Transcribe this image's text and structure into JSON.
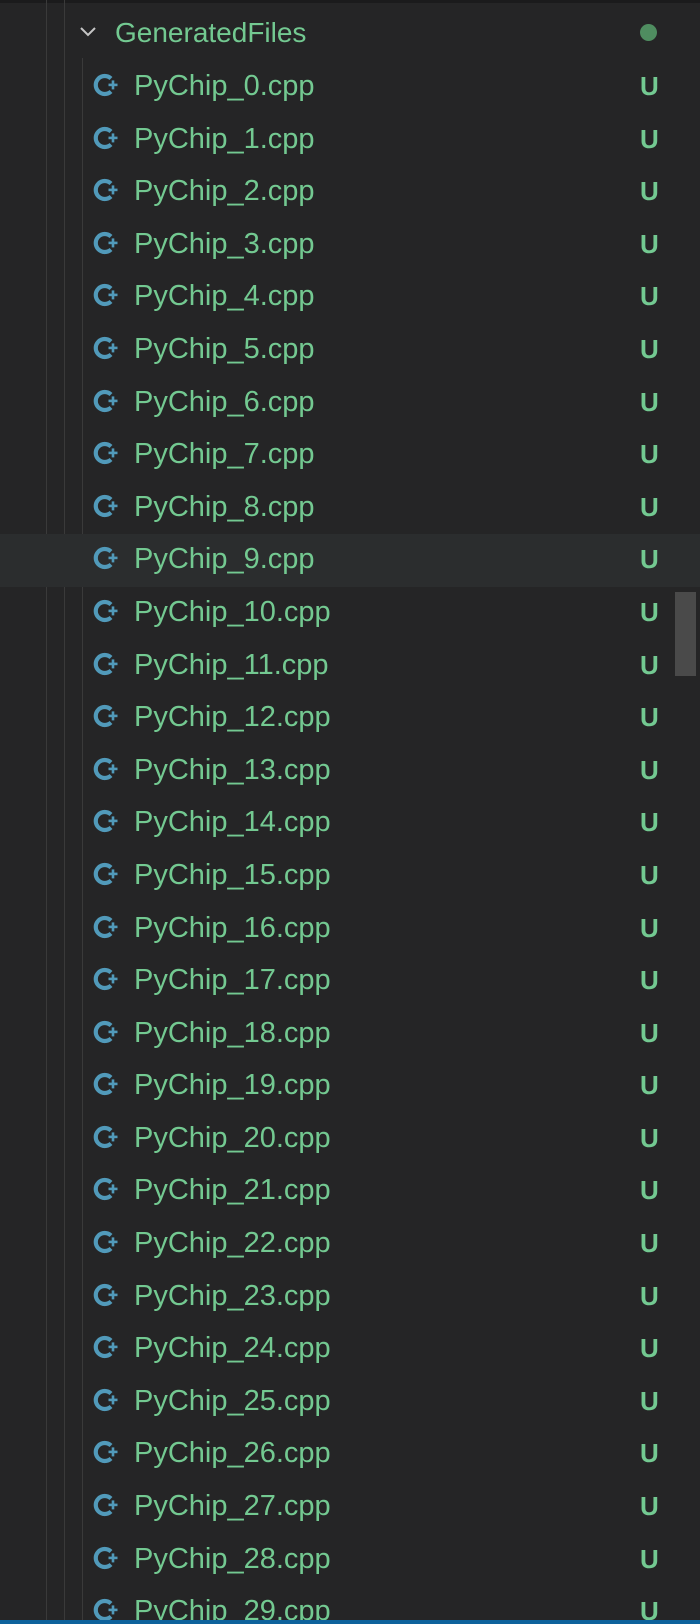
{
  "folder": {
    "label": "GeneratedFiles",
    "expanded": true,
    "modified_indicator": "dot",
    "chevron_icon": "chevron-down-icon"
  },
  "colors": {
    "background": "#252526",
    "untracked_text": "#73c991",
    "cpp_icon": "#519aba",
    "hover_row": "#2b2d2e",
    "focus_border": "#0e639c"
  },
  "file_icon": "cpp-file-icon",
  "hovered_file": "PyChip_9.cpp",
  "files": [
    {
      "name": "PyChip_0.cpp",
      "status": "U"
    },
    {
      "name": "PyChip_1.cpp",
      "status": "U"
    },
    {
      "name": "PyChip_2.cpp",
      "status": "U"
    },
    {
      "name": "PyChip_3.cpp",
      "status": "U"
    },
    {
      "name": "PyChip_4.cpp",
      "status": "U"
    },
    {
      "name": "PyChip_5.cpp",
      "status": "U"
    },
    {
      "name": "PyChip_6.cpp",
      "status": "U"
    },
    {
      "name": "PyChip_7.cpp",
      "status": "U"
    },
    {
      "name": "PyChip_8.cpp",
      "status": "U"
    },
    {
      "name": "PyChip_9.cpp",
      "status": "U"
    },
    {
      "name": "PyChip_10.cpp",
      "status": "U"
    },
    {
      "name": "PyChip_11.cpp",
      "status": "U"
    },
    {
      "name": "PyChip_12.cpp",
      "status": "U"
    },
    {
      "name": "PyChip_13.cpp",
      "status": "U"
    },
    {
      "name": "PyChip_14.cpp",
      "status": "U"
    },
    {
      "name": "PyChip_15.cpp",
      "status": "U"
    },
    {
      "name": "PyChip_16.cpp",
      "status": "U"
    },
    {
      "name": "PyChip_17.cpp",
      "status": "U"
    },
    {
      "name": "PyChip_18.cpp",
      "status": "U"
    },
    {
      "name": "PyChip_19.cpp",
      "status": "U"
    },
    {
      "name": "PyChip_20.cpp",
      "status": "U"
    },
    {
      "name": "PyChip_21.cpp",
      "status": "U"
    },
    {
      "name": "PyChip_22.cpp",
      "status": "U"
    },
    {
      "name": "PyChip_23.cpp",
      "status": "U"
    },
    {
      "name": "PyChip_24.cpp",
      "status": "U"
    },
    {
      "name": "PyChip_25.cpp",
      "status": "U"
    },
    {
      "name": "PyChip_26.cpp",
      "status": "U"
    },
    {
      "name": "PyChip_27.cpp",
      "status": "U"
    },
    {
      "name": "PyChip_28.cpp",
      "status": "U"
    },
    {
      "name": "PyChip_29.cpp",
      "status": "U"
    }
  ]
}
